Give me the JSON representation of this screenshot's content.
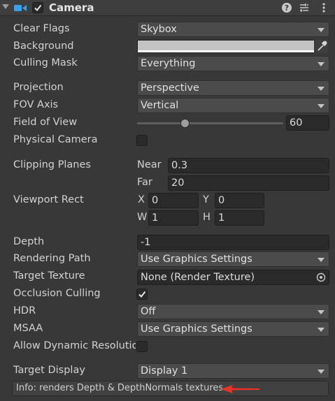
{
  "header": {
    "title": "Camera",
    "enabled": true,
    "icons": [
      "fold-arrow-icon",
      "camera-icon",
      "help-icon",
      "preset-icon",
      "more-icon"
    ],
    "accent": "#3aa0e8"
  },
  "rows": {
    "clear_flags": {
      "label": "Clear Flags",
      "value": "Skybox"
    },
    "background": {
      "label": "Background",
      "color": "#c3c3c3"
    },
    "culling_mask": {
      "label": "Culling Mask",
      "value": "Everything"
    },
    "projection": {
      "label": "Projection",
      "value": "Perspective"
    },
    "fov_axis": {
      "label": "FOV Axis",
      "value": "Vertical"
    },
    "field_of_view": {
      "label": "Field of View",
      "value": "60",
      "slider_fraction": 0.33
    },
    "physical_camera": {
      "label": "Physical Camera",
      "checked": false
    },
    "clipping_planes": {
      "label": "Clipping Planes",
      "near_label": "Near",
      "near": "0.3",
      "far_label": "Far",
      "far": "20"
    },
    "viewport_rect": {
      "label": "Viewport Rect",
      "x_label": "X",
      "x": "0",
      "y_label": "Y",
      "y": "0",
      "w_label": "W",
      "w": "1",
      "h_label": "H",
      "h": "1"
    },
    "depth": {
      "label": "Depth",
      "value": "-1"
    },
    "rendering_path": {
      "label": "Rendering Path",
      "value": "Use Graphics Settings"
    },
    "target_texture": {
      "label": "Target Texture",
      "value": "None (Render Texture)"
    },
    "occlusion_culling": {
      "label": "Occlusion Culling",
      "checked": true
    },
    "hdr": {
      "label": "HDR",
      "value": "Off"
    },
    "msaa": {
      "label": "MSAA",
      "value": "Use Graphics Settings"
    },
    "allow_dynamic_resolution": {
      "label": "Allow Dynamic Resolutio",
      "checked": false
    },
    "target_display": {
      "label": "Target Display",
      "value": "Display 1"
    }
  },
  "info": {
    "text": "Info: renders Depth & DepthNormals textures",
    "arrow_color": "#e8332b"
  }
}
